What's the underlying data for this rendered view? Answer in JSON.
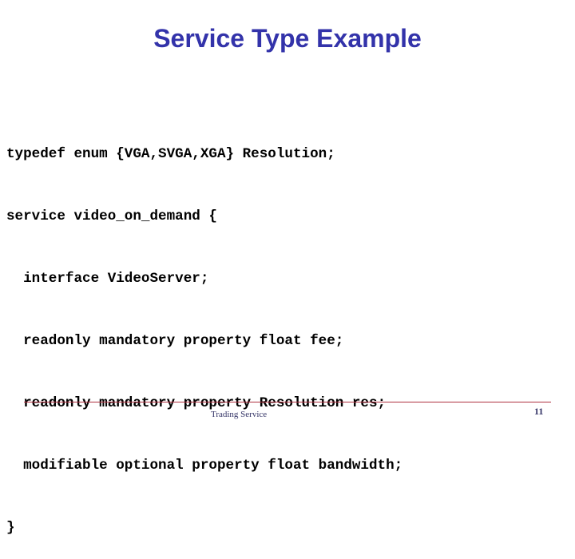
{
  "slide": {
    "title": "Service Type Example",
    "code_lines": [
      "typedef enum {VGA,SVGA,XGA} Resolution;",
      "service video_on_demand {",
      "  interface VideoServer;",
      "  readonly mandatory property float fee;",
      "  readonly mandatory property Resolution res;",
      "  modifiable optional property float bandwidth;",
      "}"
    ],
    "footer": {
      "text": "Trading Service",
      "page_number": "11"
    },
    "colors": {
      "title": "#3333aa",
      "footer_rule": "#b03040",
      "footer_text": "#333366"
    }
  }
}
